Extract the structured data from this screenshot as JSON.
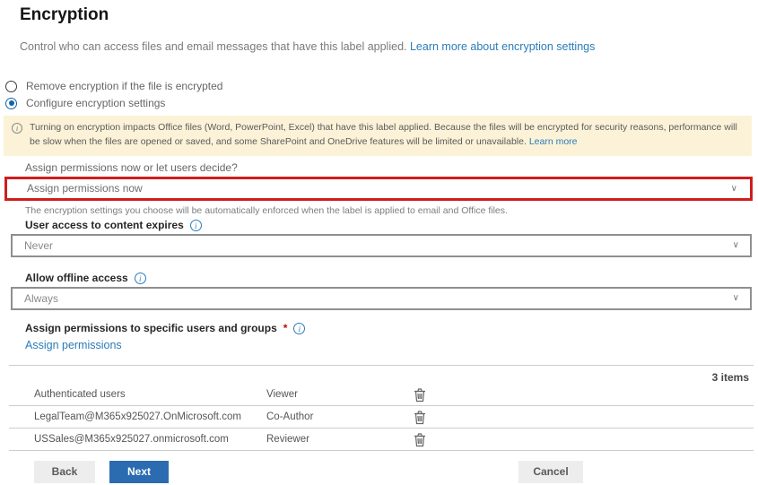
{
  "page": {
    "title": "Encryption",
    "description": "Control who can access files and email messages that have this label applied.",
    "learn_more_link": "Learn more about encryption settings"
  },
  "radios": [
    {
      "label": "Remove encryption if the file is encrypted",
      "selected": false
    },
    {
      "label": "Configure encryption settings",
      "selected": true
    }
  ],
  "banner": {
    "text": "Turning on encryption impacts Office files (Word, PowerPoint, Excel) that have this label applied. Because the files will be encrypted for security reasons, performance will be slow when the files are opened or saved, and some SharePoint and OneDrive features will be limited or unavailable.",
    "link": "Learn more"
  },
  "assign_mode": {
    "label": "Assign permissions now or let users decide?",
    "value": "Assign permissions now",
    "helper": "The encryption settings you choose will be automatically enforced when the label is applied to email and Office files."
  },
  "expires": {
    "label": "User access to content expires",
    "value": "Never"
  },
  "offline": {
    "label": "Allow offline access",
    "value": "Always"
  },
  "assign_section": {
    "label": "Assign permissions to specific users and groups",
    "required_mark": "*",
    "link": "Assign permissions"
  },
  "table": {
    "count": "3 items",
    "rows": [
      {
        "user": "Authenticated users",
        "permission": "Viewer"
      },
      {
        "user": "LegalTeam@M365x925027.OnMicrosoft.com",
        "permission": "Co-Author"
      },
      {
        "user": "USSales@M365x925027.onmicrosoft.com",
        "permission": "Reviewer"
      }
    ]
  },
  "footer": {
    "back": "Back",
    "next": "Next",
    "cancel": "Cancel"
  },
  "colors": {
    "link_blue": "#2b7cb9",
    "next_button_blue": "#2b6cb0",
    "highlight_red": "#cf1d1d",
    "banner_background": "#fbf2d7"
  }
}
